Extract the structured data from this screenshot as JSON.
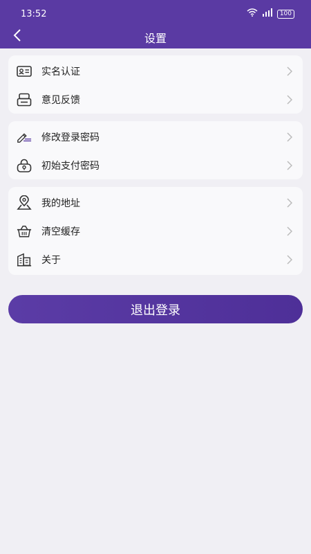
{
  "status": {
    "time": "13:52",
    "battery": "100"
  },
  "header": {
    "title": "设置"
  },
  "groups": [
    {
      "items": [
        {
          "label": "实名认证",
          "icon": "id-card-icon"
        },
        {
          "label": "意见反馈",
          "icon": "feedback-icon"
        }
      ]
    },
    {
      "items": [
        {
          "label": "修改登录密码",
          "icon": "edit-password-icon"
        },
        {
          "label": "初始支付密码",
          "icon": "lock-icon"
        }
      ]
    },
    {
      "items": [
        {
          "label": "我的地址",
          "icon": "location-icon"
        },
        {
          "label": "清空缓存",
          "icon": "basket-icon"
        },
        {
          "label": "关于",
          "icon": "building-icon"
        }
      ]
    }
  ],
  "logout_button": {
    "label": "退出登录"
  },
  "colors": {
    "primary": "#5a3aa3",
    "background": "#f0eff4",
    "card": "#f9f9fb"
  }
}
